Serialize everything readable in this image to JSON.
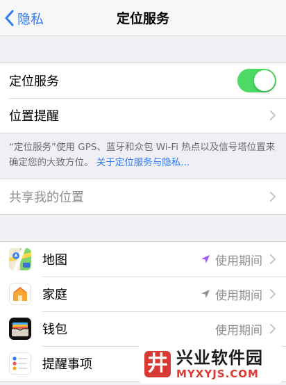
{
  "nav": {
    "back_label": "隐私",
    "title": "定位服务"
  },
  "location_services": {
    "label": "定位服务",
    "enabled": true,
    "toggle_color": "#4cd964"
  },
  "location_alerts": {
    "label": "位置提醒"
  },
  "footnote": {
    "text": "“定位服务”使用 GPS、蓝牙和众包 Wi-Fi 热点以及信号塔位置来确定您的大致方位。",
    "link": "关于定位服务与隐私..."
  },
  "share_location": {
    "label": "共享我的位置"
  },
  "apps": [
    {
      "name": "地图",
      "icon": "maps-app-icon",
      "status": "使用期间",
      "arrow_color": "#a05cf0"
    },
    {
      "name": "家庭",
      "icon": "home-app-icon",
      "status": "使用期间",
      "arrow_color": "#8e8e93"
    },
    {
      "name": "钱包",
      "icon": "wallet-app-icon",
      "status": "使用期间",
      "arrow_color": "#8e8e93"
    },
    {
      "name": "提醒事项",
      "icon": "reminders-app-icon",
      "status": "",
      "arrow_color": "#8e8e93"
    }
  ],
  "watermark": {
    "logo_char": "井",
    "name": "兴业软件园",
    "url": "MYXYJS.COM"
  },
  "colors": {
    "accent": "#2f7cf6",
    "background": "#efeff4",
    "watermark_red": "#d83a33"
  }
}
